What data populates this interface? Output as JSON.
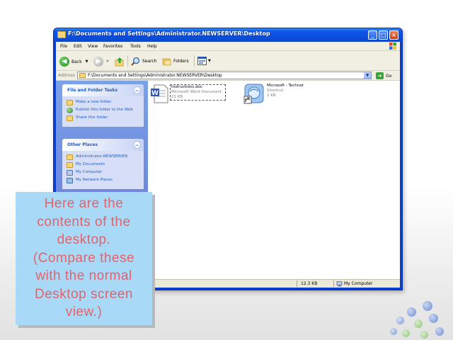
{
  "window": {
    "title": "F:\\Documents and Settings\\Administrator.NEWSERVER\\Desktop",
    "controls": {
      "minimize": "_",
      "maximize": "□",
      "close": "×"
    }
  },
  "menu": [
    "File",
    "Edit",
    "View",
    "Favorites",
    "Tools",
    "Help"
  ],
  "toolbar": {
    "back_label": "Back",
    "search_label": "Search",
    "folders_label": "Folders"
  },
  "address": {
    "label": "Address",
    "value": "F:\\Documents and Settings\\Administrator.NEWSERVER\\Desktop",
    "go_label": "Go"
  },
  "tasks": {
    "file_folder": {
      "title": "File and Folder Tasks",
      "items": [
        "Make a new folder",
        "Publish this folder to the Web",
        "Share this folder"
      ]
    },
    "other_places": {
      "title": "Other Places",
      "items": [
        "Administrator.NEWSERVER",
        "My Documents",
        "My Computer",
        "My Network Places"
      ]
    }
  },
  "files": [
    {
      "name": "Instructions.doc",
      "type": "Microsoft Word Document",
      "size": "21 KB",
      "icon": "word-doc-icon"
    },
    {
      "name": "Microsoft - Technet",
      "type": "Shortcut",
      "size": "2 KB",
      "icon": "technet-shortcut-icon"
    }
  ],
  "status": {
    "size": "12.3 KB",
    "location": "My Computer"
  },
  "callout": {
    "lines": [
      "Here are the",
      "contents of the",
      "desktop.",
      "(Compare these",
      "with the normal",
      "Desktop screen",
      "view.)"
    ]
  },
  "colors": {
    "titlebar": "#0a4fe0",
    "task_pane": "#6f8ddf",
    "callout_bg": "#a8daf8",
    "callout_text": "#e4626a"
  }
}
